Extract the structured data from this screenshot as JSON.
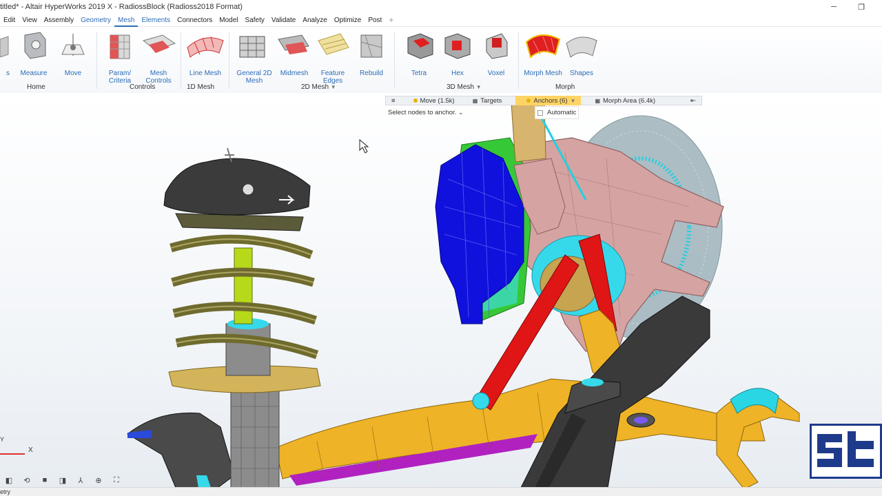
{
  "titlebar": {
    "title": "titled* - Altair HyperWorks 2019 X - RadiossBlock (Radioss2018 Format)",
    "minimize_icon": "minimize-icon",
    "restore_icon": "restore-icon"
  },
  "menubar": {
    "items": [
      "Edit",
      "View",
      "Assembly",
      "Geometry",
      "Mesh",
      "Elements",
      "Connectors",
      "Model",
      "Safety",
      "Validate",
      "Analyze",
      "Optimize",
      "Post"
    ],
    "active": "Mesh",
    "plus": "+"
  },
  "ribbon": {
    "tools": [
      {
        "label": "s",
        "icon": "tool-icon"
      },
      {
        "label": "Measure",
        "icon": "measure-icon"
      },
      {
        "label": "Move",
        "icon": "move-icon"
      },
      {
        "label": "Param/\nCriteria",
        "icon": "param-criteria-icon"
      },
      {
        "label": "Mesh\nControls",
        "icon": "mesh-controls-icon"
      },
      {
        "label": "Line Mesh",
        "icon": "line-mesh-icon"
      },
      {
        "label": "General 2D\nMesh",
        "icon": "general-2d-mesh-icon"
      },
      {
        "label": "Midmesh",
        "icon": "midmesh-icon"
      },
      {
        "label": "Feature\nEdges",
        "icon": "feature-edges-icon"
      },
      {
        "label": "Rebuild",
        "icon": "rebuild-icon"
      },
      {
        "label": "Tetra",
        "icon": "tetra-icon"
      },
      {
        "label": "Hex",
        "icon": "hex-icon"
      },
      {
        "label": "Voxel",
        "icon": "voxel-icon"
      },
      {
        "label": "Morph Mesh",
        "icon": "morph-mesh-icon"
      },
      {
        "label": "Shapes",
        "icon": "shapes-icon"
      }
    ],
    "groups": [
      "Home",
      "Controls",
      "1D Mesh",
      "2D Mesh",
      "3D Mesh",
      "Morph"
    ]
  },
  "morphbar": {
    "menu_icon": "≡",
    "items": [
      "Move (1.5k)",
      "Targets",
      "Anchors (6)",
      "Morph Area (6.4k)"
    ],
    "active": "Anchors (6)",
    "end_icon": "⇤",
    "hint": "Select nodes to anchor.",
    "automatic_label": "Automatic",
    "automatic_checked": false
  },
  "triad": {
    "x": "X",
    "y": "Y"
  },
  "statusbar": {
    "text": "etry"
  },
  "viewtools": [
    "view-icon",
    "rotate-icon",
    "cube-icon",
    "clip-icon",
    "axes-icon",
    "zoom-icon",
    "fit-icon"
  ],
  "colors": {
    "accent": "#2b6cb5",
    "active_tab": "#ffd466",
    "logo": "#1e3a8a"
  }
}
